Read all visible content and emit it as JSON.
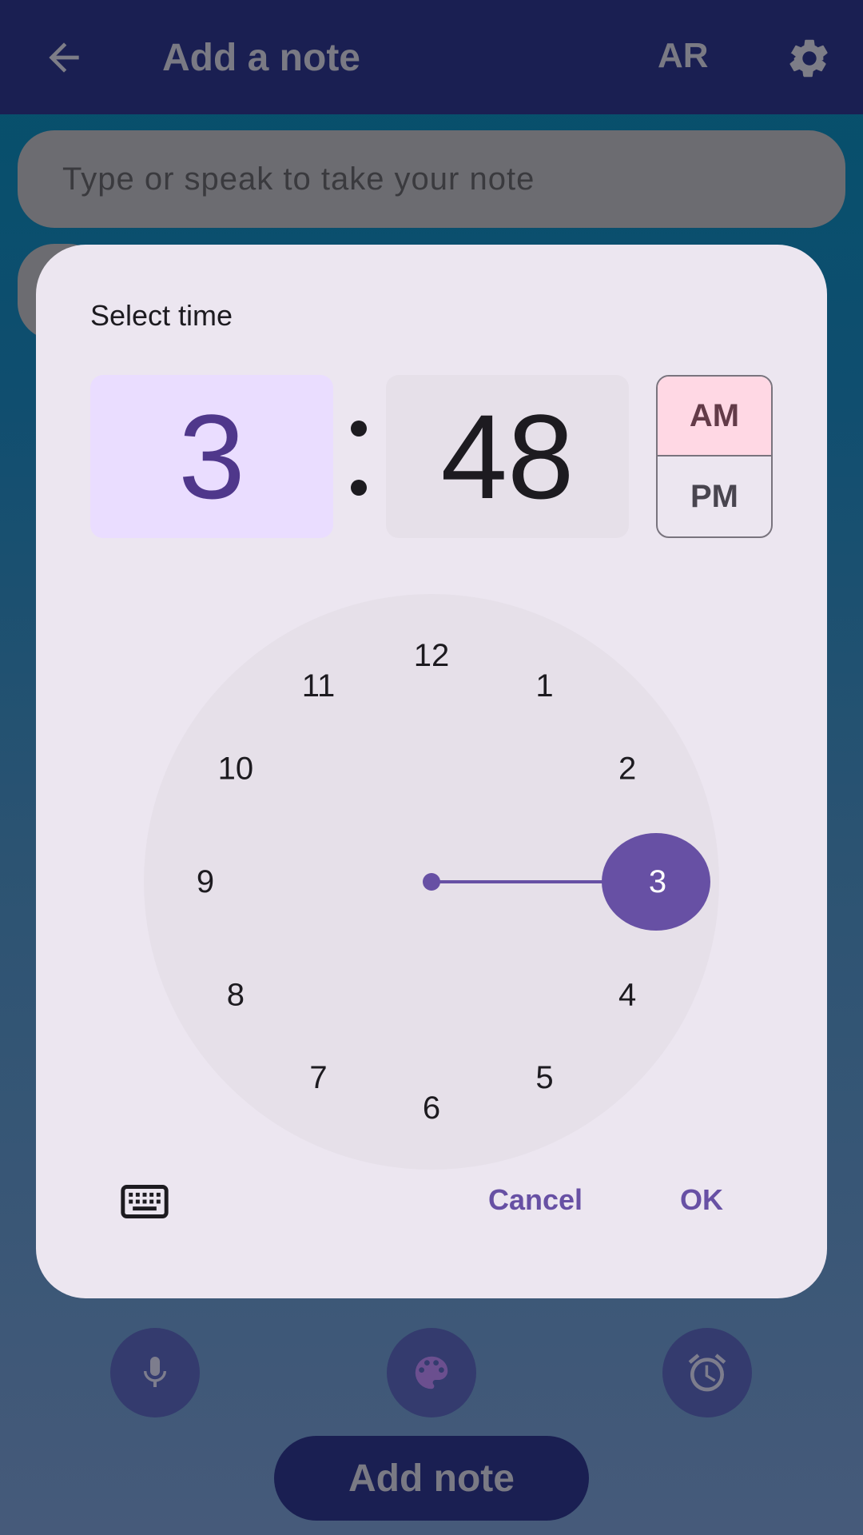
{
  "appbar": {
    "title": "Add a note",
    "lang": "AR",
    "back_icon": "arrow-back-icon",
    "settings_icon": "gear-icon"
  },
  "note_input": {
    "placeholder": "Type or speak to take your note"
  },
  "dialog": {
    "heading": "Select time",
    "hour": "3",
    "minute": "48",
    "am": "AM",
    "pm": "PM",
    "period_selected": "AM",
    "clock_numbers": [
      "12",
      "1",
      "2",
      "3",
      "4",
      "5",
      "6",
      "7",
      "8",
      "9",
      "10",
      "11"
    ],
    "selected_hour": "3",
    "keyboard_icon": "keyboard-icon",
    "cancel": "Cancel",
    "ok": "OK"
  },
  "bottom": {
    "mic_icon": "mic-icon",
    "palette_icon": "palette-icon",
    "alarm_icon": "alarm-icon",
    "add_note": "Add note"
  },
  "colors": {
    "primary": "#6750a4",
    "hour_selected_bg": "#eaddff",
    "am_selected_bg": "#ffd8e4",
    "dialog_bg": "#ece6f0",
    "appbar_bg": "#1a1f52"
  }
}
